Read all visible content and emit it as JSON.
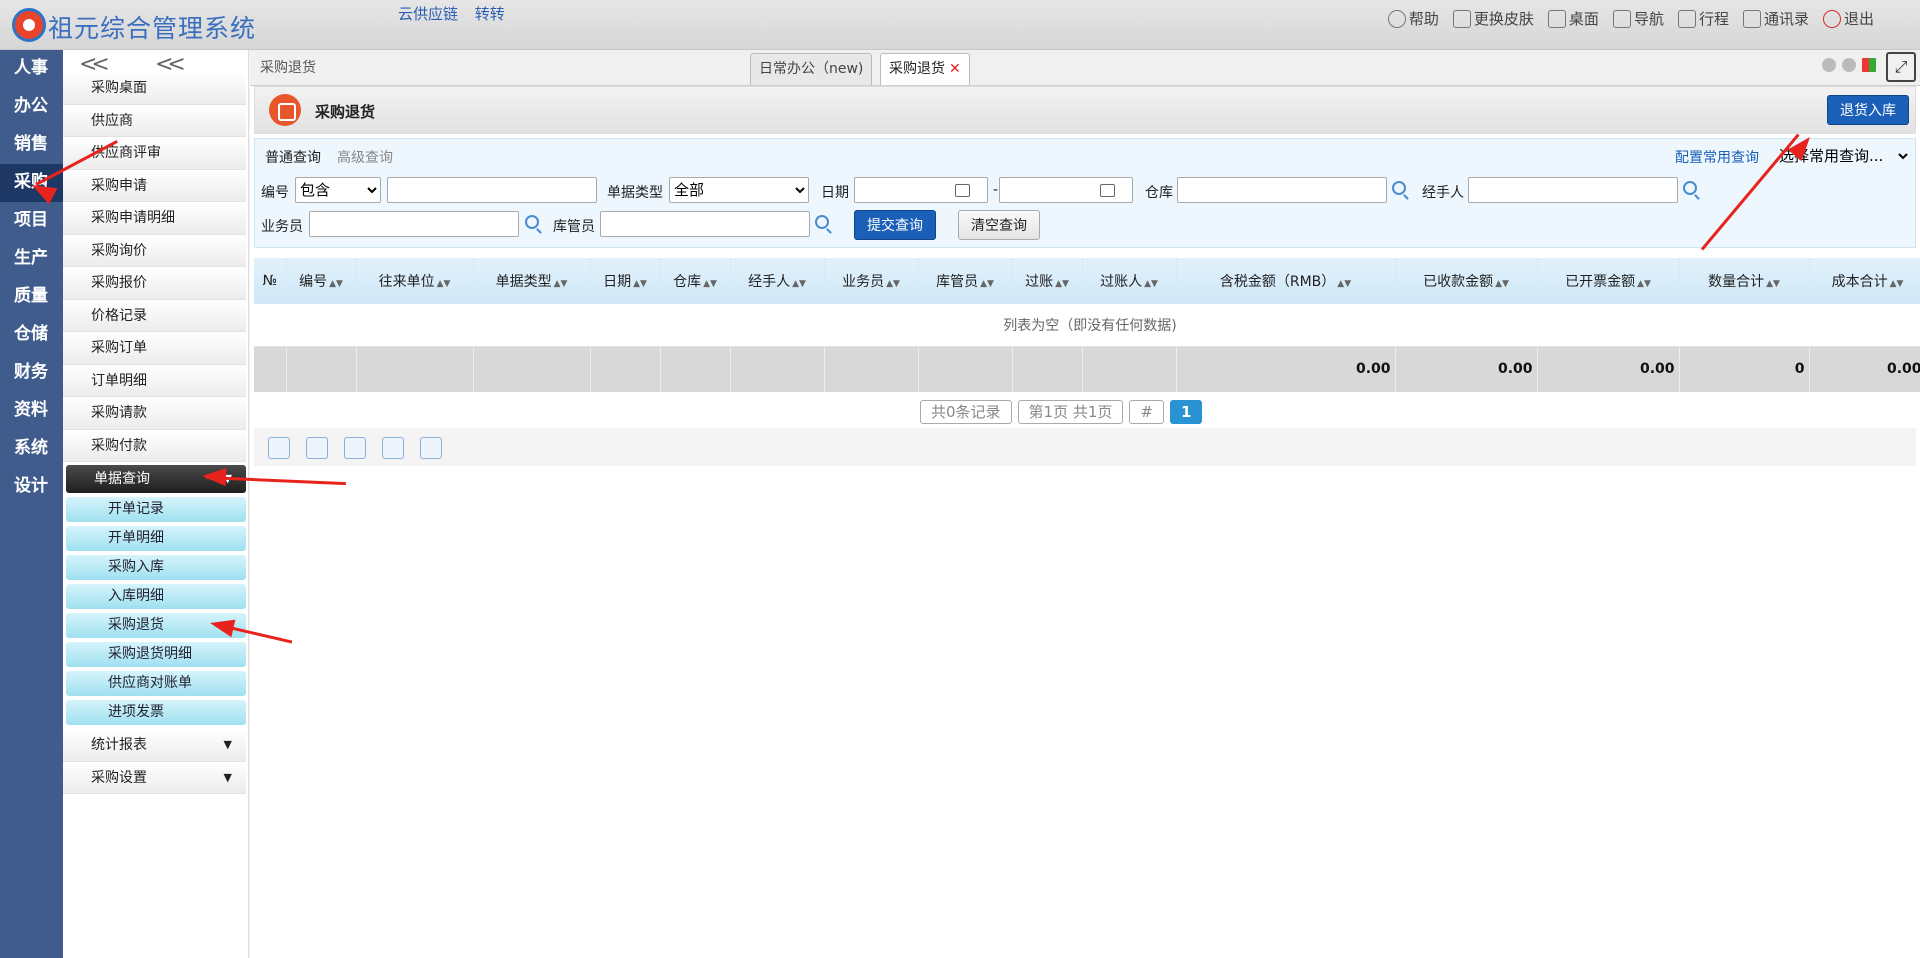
{
  "app": {
    "title": "祖元综合管理系统",
    "top_links": [
      "云供应链",
      "转转"
    ],
    "top_actions": [
      {
        "label": "帮助",
        "icon": "help-icon"
      },
      {
        "label": "更换皮肤",
        "icon": "shirt-icon"
      },
      {
        "label": "桌面",
        "icon": "home-icon"
      },
      {
        "label": "导航",
        "icon": "grid-icon"
      },
      {
        "label": "行程",
        "icon": "calendar-icon"
      },
      {
        "label": "通讯录",
        "icon": "contacts-icon"
      },
      {
        "label": "退出",
        "icon": "power-icon"
      }
    ]
  },
  "leftnav": [
    "人事",
    "办公",
    "销售",
    "采购",
    "项目",
    "生产",
    "质量",
    "仓储",
    "财务",
    "资料",
    "系统",
    "设计"
  ],
  "leftnav_active": "采购",
  "sidebar": {
    "collapse_label": "<<",
    "items": [
      "采购桌面",
      "供应商",
      "供应商评审",
      "采购申请",
      "采购申请明细",
      "采购询价",
      "采购报价",
      "价格记录",
      "采购订单",
      "订单明细",
      "采购请款",
      "采购付款"
    ],
    "group_open": "单据查询",
    "sub_items": [
      "开单记录",
      "开单明细",
      "采购入库",
      "入库明细",
      "采购退货",
      "采购退货明细",
      "供应商对账单",
      "进项发票"
    ],
    "collapsed_groups": [
      "统计报表",
      "采购设置"
    ]
  },
  "tabs": {
    "breadcrumb": "采购退货",
    "items": [
      {
        "label": "日常办公（new)"
      },
      {
        "label": "采购退货",
        "close": "✕"
      }
    ]
  },
  "page": {
    "title": "采购退货",
    "return_button": "退货入库"
  },
  "query": {
    "tab_normal": "普通查询",
    "tab_advanced": "高级查询",
    "config_link": "配置常用查询",
    "common_select": "选择常用查询...",
    "no_label": "编号",
    "no_mode": "包含",
    "type_label": "单据类型",
    "type_value": "全部",
    "date_label": "日期",
    "date_sep": "-",
    "warehouse_label": "仓库",
    "handler_label": "经手人",
    "salesman_label": "业务员",
    "keeper_label": "库管员",
    "submit_button": "提交查询",
    "clear_button": "清空查询"
  },
  "grid": {
    "columns": [
      "№",
      "编号",
      "往来单位",
      "单据类型",
      "日期",
      "仓库",
      "经手人",
      "业务员",
      "库管员",
      "过账",
      "过账人",
      "含税金额（RMB）",
      "已收款金额",
      "已开票金额",
      "数量合计",
      "成本合计"
    ],
    "empty_text": "列表为空（即没有任何数据)",
    "totals": [
      "",
      "",
      "",
      "",
      "",
      "",
      "",
      "",
      "",
      "",
      "",
      "0.00",
      "0.00",
      "0.00",
      "0",
      "0.00"
    ]
  },
  "pager": {
    "records": "共0条记录",
    "pages": "第1页 共1页",
    "hash": "#",
    "current": "1"
  },
  "colors": {
    "nav_bg": "#3f5c8c",
    "primary": "#1a5fb8",
    "annotation": "#e8231e"
  }
}
